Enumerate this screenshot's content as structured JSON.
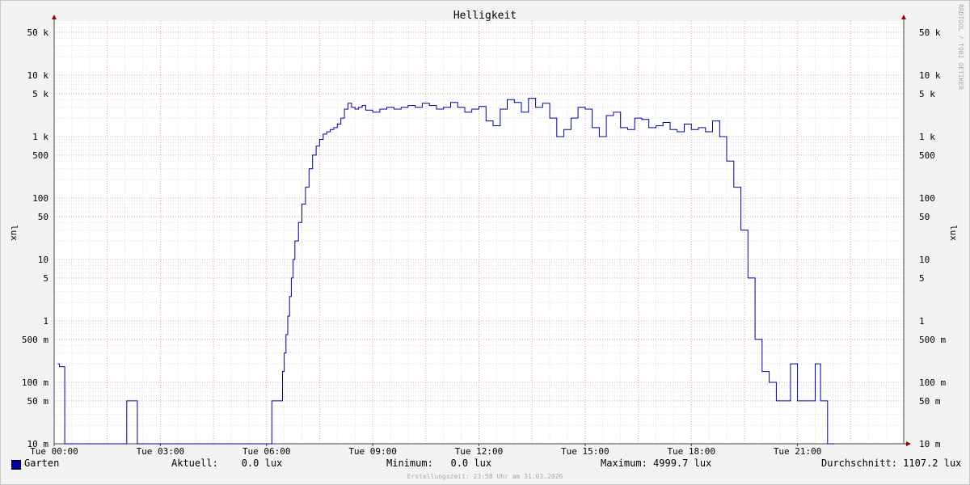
{
  "chart_data": {
    "type": "line",
    "title": "Helligkeit",
    "ylabel": "lux",
    "yscale": "log",
    "ylim": [
      0.01,
      100000
    ],
    "y_ticks": [
      {
        "value": 50000,
        "label": "50 k"
      },
      {
        "value": 10000,
        "label": "10 k"
      },
      {
        "value": 5000,
        "label": "5 k"
      },
      {
        "value": 1000,
        "label": "1 k"
      },
      {
        "value": 500,
        "label": "500"
      },
      {
        "value": 100,
        "label": "100"
      },
      {
        "value": 50,
        "label": "50"
      },
      {
        "value": 10,
        "label": "10"
      },
      {
        "value": 5,
        "label": "5"
      },
      {
        "value": 1,
        "label": "1"
      },
      {
        "value": 0.5,
        "label": "500 m"
      },
      {
        "value": 0.1,
        "label": "100 m"
      },
      {
        "value": 0.05,
        "label": "50 m"
      },
      {
        "value": 0.01,
        "label": "10 m"
      }
    ],
    "x_ticks": [
      "Tue 00:00",
      "Tue 03:00",
      "Tue 06:00",
      "Tue 09:00",
      "Tue 12:00",
      "Tue 15:00",
      "Tue 18:00",
      "Tue 21:00"
    ],
    "xlim_hours": [
      0,
      24
    ],
    "grid": true,
    "series": [
      {
        "name": "Garten",
        "color": "#0000a0",
        "x_hours": [
          0.1,
          0.15,
          0.25,
          0.3,
          2.0,
          2.05,
          2.3,
          2.35,
          6.1,
          6.15,
          6.4,
          6.45,
          6.5,
          6.55,
          6.6,
          6.65,
          6.7,
          6.75,
          6.8,
          6.9,
          7.0,
          7.1,
          7.2,
          7.3,
          7.4,
          7.5,
          7.6,
          7.7,
          7.8,
          7.9,
          8.0,
          8.1,
          8.2,
          8.3,
          8.4,
          8.5,
          8.6,
          8.7,
          8.8,
          9.0,
          9.2,
          9.4,
          9.6,
          9.8,
          10.0,
          10.2,
          10.4,
          10.6,
          10.8,
          11.0,
          11.2,
          11.4,
          11.6,
          11.8,
          12.0,
          12.2,
          12.4,
          12.6,
          12.8,
          13.0,
          13.2,
          13.4,
          13.6,
          13.8,
          14.0,
          14.2,
          14.4,
          14.6,
          14.8,
          15.0,
          15.2,
          15.4,
          15.6,
          15.8,
          16.0,
          16.2,
          16.4,
          16.6,
          16.8,
          17.0,
          17.2,
          17.4,
          17.6,
          17.8,
          18.0,
          18.2,
          18.4,
          18.6,
          18.8,
          19.0,
          19.2,
          19.4,
          19.6,
          19.8,
          20.0,
          20.2,
          20.4,
          20.6,
          20.8,
          20.9,
          21.0,
          21.2,
          21.4,
          21.5,
          21.6,
          21.65,
          21.7,
          21.85,
          22.0,
          22.05,
          22.5,
          22.75,
          22.85,
          22.9,
          23.1,
          23.3,
          23.5,
          23.55,
          23.99
        ],
        "values": [
          0.2,
          0.18,
          0.18,
          0.005,
          0.005,
          0.05,
          0.05,
          0.005,
          0.005,
          0.05,
          0.05,
          0.15,
          0.3,
          0.6,
          1.2,
          2.5,
          5,
          10,
          20,
          40,
          80,
          150,
          300,
          500,
          700,
          900,
          1100,
          1200,
          1300,
          1400,
          1600,
          2000,
          2800,
          3500,
          3000,
          2800,
          3000,
          3200,
          2700,
          2500,
          2800,
          3000,
          2800,
          3000,
          3200,
          3000,
          3500,
          3200,
          2800,
          3000,
          3600,
          3000,
          2500,
          2800,
          3100,
          1800,
          1500,
          2800,
          4000,
          3600,
          2500,
          4200,
          3000,
          3500,
          2000,
          1000,
          1300,
          2000,
          3000,
          2800,
          1400,
          1000,
          2200,
          2500,
          1400,
          1300,
          2000,
          1900,
          1400,
          1500,
          1700,
          1300,
          1200,
          1600,
          1300,
          1400,
          1200,
          1800,
          1000,
          400,
          150,
          30,
          5,
          0.5,
          0.15,
          0.1,
          0.05,
          0.05,
          0.2,
          0.2,
          0.05,
          0.05,
          0.05,
          0.2,
          0.2,
          0.05,
          0.05,
          0.005,
          0.005
        ]
      }
    ]
  },
  "legend": {
    "series_name": "Garten",
    "aktuell": "Aktuell:    0.0 lux",
    "minimum": "Minimum:   0.0 lux",
    "maximum": "Maximum: 4999.7 lux",
    "durchschnitt": "Durchschnitt: 1107.2 lux"
  },
  "footer": "Erstellungszeit: 23:58 Uhr am 31.03.2026",
  "watermark": "RRDTOOL / TOBI OETIKER"
}
